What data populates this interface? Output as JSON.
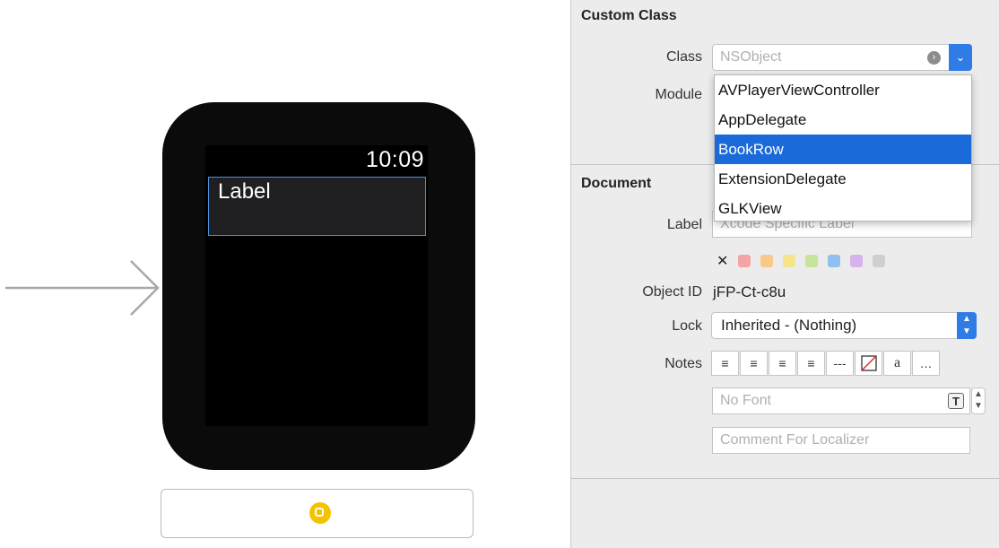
{
  "canvas": {
    "clock": "10:09",
    "label": "Label"
  },
  "custom_class": {
    "title": "Custom Class",
    "class_label": "Class",
    "class_placeholder": "NSObject",
    "module_label": "Module",
    "dropdown_items": [
      "AVPlayerViewController",
      "AppDelegate",
      "BookRow",
      "ExtensionDelegate",
      "GLKView"
    ],
    "selected_item": "BookRow"
  },
  "document": {
    "title": "Document",
    "label_label": "Label",
    "label_placeholder": "Xcode Specific Label",
    "clear_mark": "✕",
    "swatch_colors": [
      "#f4a4a4",
      "#f9c98a",
      "#f6e48a",
      "#c8e39a",
      "#8fc0ef",
      "#d6b3ec",
      "#cfcfcf"
    ],
    "object_id_label": "Object ID",
    "object_id": "jFP-Ct-c8u",
    "lock_label": "Lock",
    "lock_value": "Inherited - (Nothing)",
    "notes_label": "Notes",
    "notes_buttons": [
      "≡",
      "≡",
      "≡",
      "≡",
      "---",
      "",
      "a",
      "…"
    ],
    "font_placeholder": "No Font",
    "comment_placeholder": "Comment For Localizer"
  }
}
